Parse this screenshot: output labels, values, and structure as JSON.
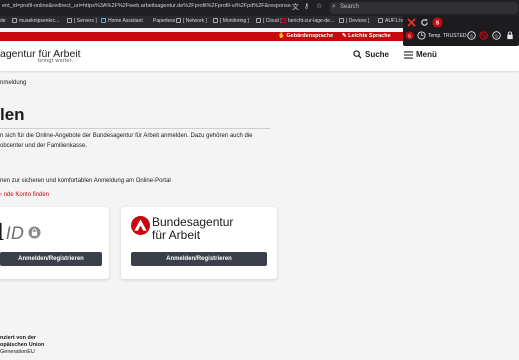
{
  "browser": {
    "url": "ent_id=profil-online&redirect_uri=https%3A%2F%2Fweb.arbeitsagentur.de%2Fprofil%2Fprofil-ui%2Fpd%2F&response...",
    "search_placeholder": "Search",
    "bookmarks": [
      {
        "label": "de"
      },
      {
        "label": "museknipsenkrc..."
      },
      {
        "label": "[ Servers ]"
      },
      {
        "label": "Home Assistant"
      },
      {
        "label": "Paperless"
      },
      {
        "label": "[ Network ]"
      },
      {
        "label": "[ Monitoring ]"
      },
      {
        "label": "[ Cloud ]"
      },
      {
        "label": "bericht-zur-lage-de..."
      },
      {
        "label": "[ Devices ]"
      },
      {
        "label": "AUF1.tv - A"
      }
    ]
  },
  "extension_popup": {
    "trust_label": "Temp. TRUSTED"
  },
  "service_bar": {
    "sign_language": "Gebärdensprache",
    "easy_language": "Leichte Sprache"
  },
  "header": {
    "logo_text": "agentur für Arbeit",
    "logo_sub": "bringt weiter.",
    "search_label": "Suche",
    "menu_label": "Menü"
  },
  "main": {
    "breadcrumb": "nmeldung",
    "title": "len",
    "intro_line1": "n sich für die Online-Angebote der Bundesagentur für Arbeit anmelden. Dazu gehören auch die",
    "intro_line2": "obcenter und der Familienkasse.",
    "bundid_intro": "nen zur sicheren und komfortablen Anmeldung am Online-Portal",
    "find_account_link": "nde Konto finden"
  },
  "cards": {
    "bundid": {
      "logo_d": "d",
      "logo_id": "ID",
      "button_label": "Anmelden/Registrieren"
    },
    "ba": {
      "name_line1": "Bundesagentur",
      "name_line2": "für Arbeit",
      "button_label": "Anmelden/Registrieren"
    }
  },
  "footer": {
    "line1": "nziert von der",
    "line2": "opäischen Union",
    "line3": "GenerationEU"
  },
  "colors": {
    "brand_red": "#c50a0f",
    "button_dark": "#3a3f4a"
  }
}
